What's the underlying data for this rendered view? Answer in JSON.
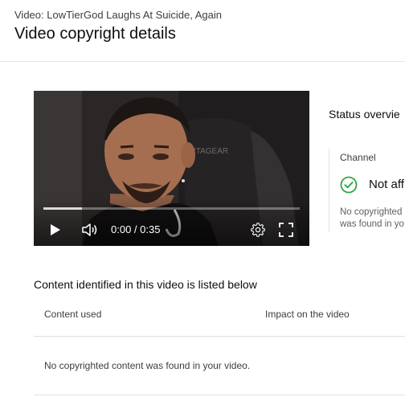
{
  "header": {
    "video_subtitle": "Video: LowTierGod Laughs At Suicide, Again",
    "title": "Video copyright details"
  },
  "player": {
    "time_display": "0:00 / 0:35",
    "progress_fraction": 0.15,
    "icons": [
      "play-icon",
      "volume-icon",
      "settings-gear-icon",
      "fullscreen-icon"
    ]
  },
  "status": {
    "title": "Status overvie",
    "channel_label": "Channel",
    "channel_value": "Not aff",
    "note_line1": "No copyrighted",
    "note_line2": "was found in yo",
    "status_color": "#2ba640"
  },
  "content": {
    "heading": "Content identified in this video is listed below",
    "columns": [
      "Content used",
      "Impact on the video"
    ],
    "empty_message": "No copyrighted content was found in your video."
  }
}
